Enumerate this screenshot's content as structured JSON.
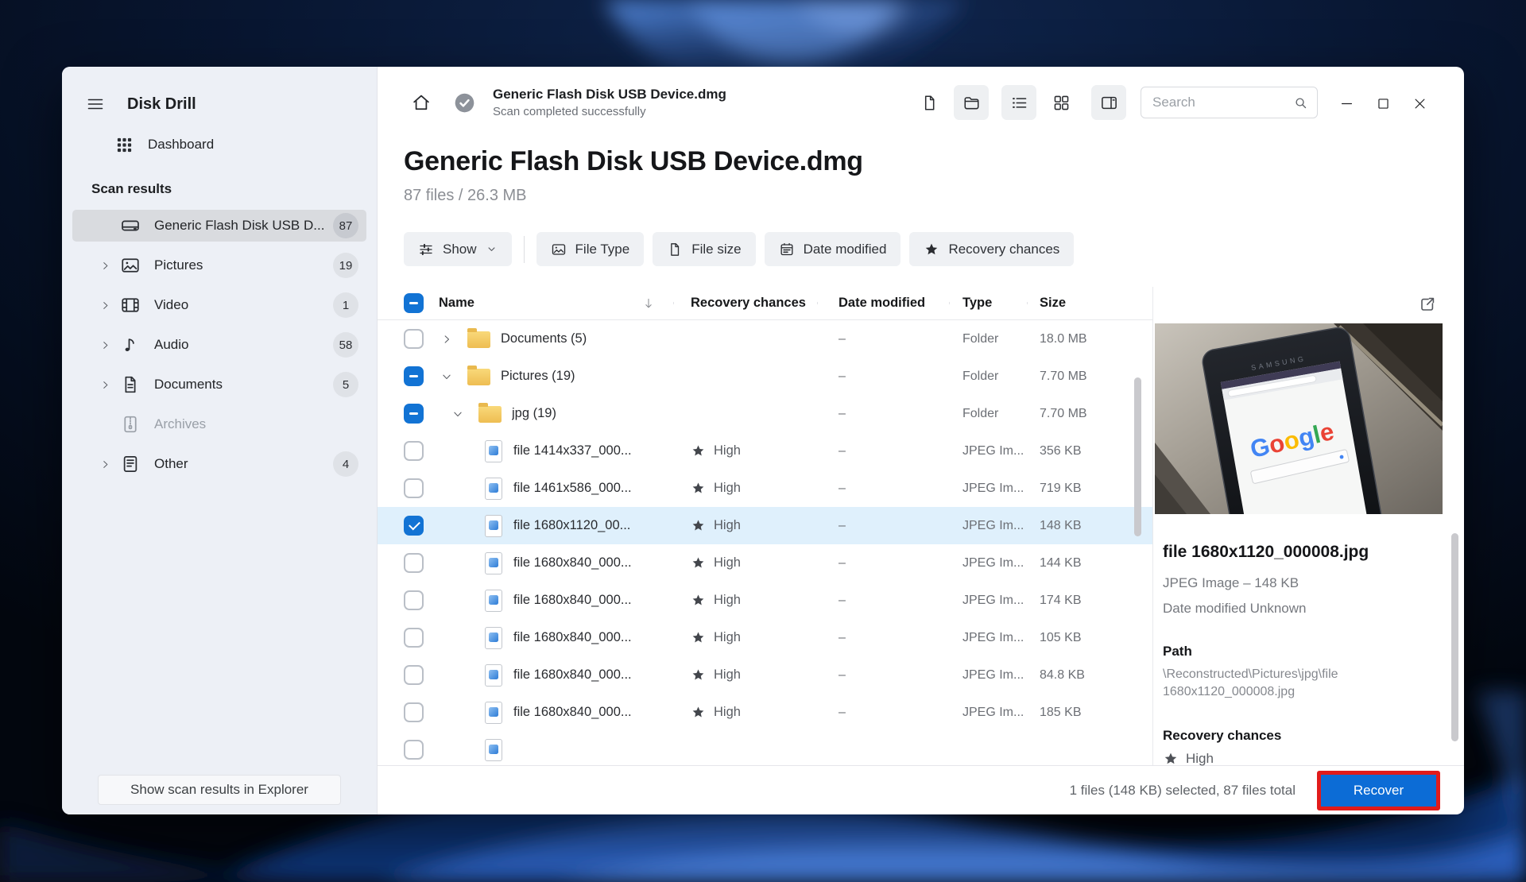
{
  "app": {
    "title": "Disk Drill"
  },
  "sidebar": {
    "dashboard_label": "Dashboard",
    "section_header": "Scan results",
    "items": [
      {
        "label": "Generic Flash Disk USB D...",
        "count": "87",
        "icon": "drive",
        "selected": true,
        "chevron": false,
        "disabled": false
      },
      {
        "label": "Pictures",
        "count": "19",
        "icon": "picture",
        "selected": false,
        "chevron": true,
        "disabled": false
      },
      {
        "label": "Video",
        "count": "1",
        "icon": "video",
        "selected": false,
        "chevron": true,
        "disabled": false
      },
      {
        "label": "Audio",
        "count": "58",
        "icon": "audio",
        "selected": false,
        "chevron": true,
        "disabled": false
      },
      {
        "label": "Documents",
        "count": "5",
        "icon": "document",
        "selected": false,
        "chevron": true,
        "disabled": false
      },
      {
        "label": "Archives",
        "count": "",
        "icon": "archive",
        "selected": false,
        "chevron": false,
        "disabled": true
      },
      {
        "label": "Other",
        "count": "4",
        "icon": "other",
        "selected": false,
        "chevron": true,
        "disabled": false
      }
    ],
    "footer_button": "Show scan results in Explorer"
  },
  "header": {
    "scan_title": "Generic Flash Disk USB Device.dmg",
    "scan_status": "Scan completed successfully",
    "search_placeholder": "Search"
  },
  "content": {
    "title": "Generic Flash Disk USB Device.dmg",
    "subtitle": "87 files / 26.3 MB",
    "show_filter": "Show",
    "filter_buttons": [
      {
        "label": "File Type",
        "icon": "picture"
      },
      {
        "label": "File size",
        "icon": "page"
      },
      {
        "label": "Date modified",
        "icon": "calendar"
      },
      {
        "label": "Recovery chances",
        "icon": "star"
      }
    ]
  },
  "table": {
    "columns": [
      "Name",
      "Recovery chances",
      "Date modified",
      "Type",
      "Size"
    ],
    "rows": [
      {
        "name": "Documents (5)",
        "kind": "folder",
        "level": 1,
        "chevron": "right",
        "check": "none",
        "recovery": "",
        "date": "–",
        "type": "Folder",
        "size": "18.0 MB",
        "selected": false
      },
      {
        "name": "Pictures (19)",
        "kind": "folder",
        "level": 1,
        "chevron": "down",
        "check": "ind",
        "recovery": "",
        "date": "–",
        "type": "Folder",
        "size": "7.70 MB",
        "selected": false
      },
      {
        "name": "jpg (19)",
        "kind": "folder",
        "level": 2,
        "chevron": "down",
        "check": "ind",
        "recovery": "",
        "date": "–",
        "type": "Folder",
        "size": "7.70 MB",
        "selected": false
      },
      {
        "name": "file 1414x337_000...",
        "kind": "jpeg",
        "level": 3,
        "chevron": "",
        "check": "none",
        "recovery": "High",
        "date": "–",
        "type": "JPEG Im...",
        "size": "356 KB",
        "selected": false
      },
      {
        "name": "file 1461x586_000...",
        "kind": "jpeg",
        "level": 3,
        "chevron": "",
        "check": "none",
        "recovery": "High",
        "date": "–",
        "type": "JPEG Im...",
        "size": "719 KB",
        "selected": false
      },
      {
        "name": "file 1680x1120_00...",
        "kind": "jpeg",
        "level": 3,
        "chevron": "",
        "check": "checked",
        "recovery": "High",
        "date": "–",
        "type": "JPEG Im...",
        "size": "148 KB",
        "selected": true
      },
      {
        "name": "file 1680x840_000...",
        "kind": "jpeg",
        "level": 3,
        "chevron": "",
        "check": "none",
        "recovery": "High",
        "date": "–",
        "type": "JPEG Im...",
        "size": "144 KB",
        "selected": false
      },
      {
        "name": "file 1680x840_000...",
        "kind": "jpeg",
        "level": 3,
        "chevron": "",
        "check": "none",
        "recovery": "High",
        "date": "–",
        "type": "JPEG Im...",
        "size": "174 KB",
        "selected": false
      },
      {
        "name": "file 1680x840_000...",
        "kind": "jpeg",
        "level": 3,
        "chevron": "",
        "check": "none",
        "recovery": "High",
        "date": "–",
        "type": "JPEG Im...",
        "size": "105 KB",
        "selected": false
      },
      {
        "name": "file 1680x840_000...",
        "kind": "jpeg",
        "level": 3,
        "chevron": "",
        "check": "none",
        "recovery": "High",
        "date": "–",
        "type": "JPEG Im...",
        "size": "84.8 KB",
        "selected": false
      },
      {
        "name": "file 1680x840_000...",
        "kind": "jpeg",
        "level": 3,
        "chevron": "",
        "check": "none",
        "recovery": "High",
        "date": "–",
        "type": "JPEG Im...",
        "size": "185 KB",
        "selected": false
      },
      {
        "name": "",
        "kind": "jpeg",
        "level": 3,
        "chevron": "",
        "check": "none",
        "recovery": "",
        "date": "",
        "type": "",
        "size": "",
        "selected": false
      }
    ]
  },
  "preview": {
    "file_name": "file 1680x1120_000008.jpg",
    "meta": "JPEG Image – 148 KB",
    "date_modified": "Date modified Unknown",
    "path_label": "Path",
    "path": "\\Reconstructed\\Pictures\\jpg\\file 1680x1120_000008.jpg",
    "recovery_label": "Recovery chances",
    "recovery_value": "High",
    "bezel_text": "SAMSUNG",
    "screen_text": "Google"
  },
  "footer": {
    "status": "1 files (148 KB) selected, 87 files total",
    "recover_label": "Recover"
  },
  "colors": {
    "accent_blue": "#1273d4",
    "recover_blue": "#0c6cd6",
    "selected_row": "#dff0fc",
    "highlight_red": "#e11b1b",
    "sidebar_bg": "#edf0f6",
    "google_letters": [
      "#4285F4",
      "#EA4335",
      "#FBBC05",
      "#4285F4",
      "#34A853",
      "#EA4335"
    ]
  }
}
